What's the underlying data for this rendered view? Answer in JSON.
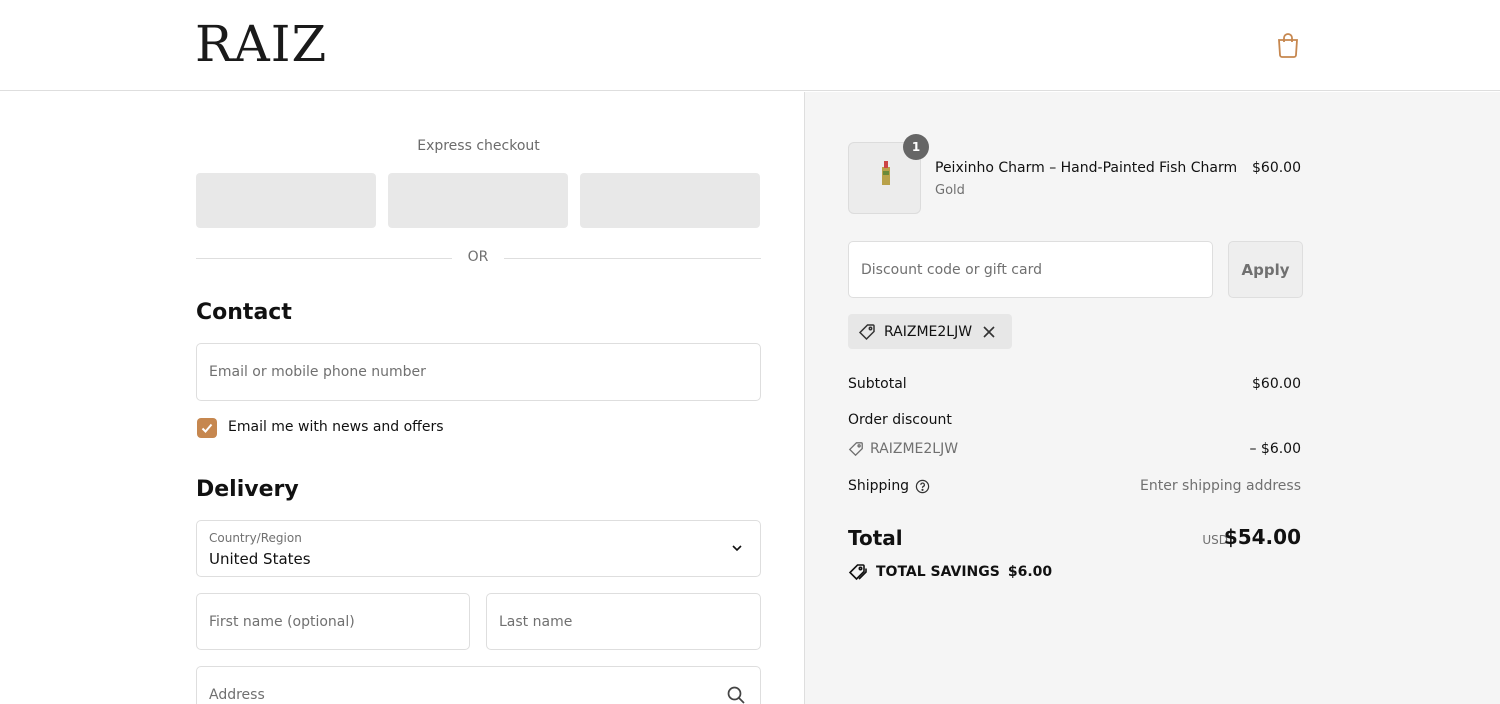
{
  "header": {
    "brand": "RAIZ",
    "cart_icon": "shopping-bag-icon"
  },
  "express": {
    "title": "Express checkout",
    "or_label": "OR"
  },
  "contact": {
    "title": "Contact",
    "email_placeholder": "Email or mobile phone number",
    "newsletter_label": "Email me with news and offers",
    "newsletter_checked": true
  },
  "delivery": {
    "title": "Delivery",
    "country_label": "Country/Region",
    "country_value": "United States",
    "first_name_placeholder": "First name (optional)",
    "last_name_placeholder": "Last name",
    "address_placeholder": "Address"
  },
  "summary": {
    "product": {
      "quantity": "1",
      "name": "Peixinho Charm – Hand-Painted Fish Charm",
      "variant": "Gold",
      "price": "$60.00"
    },
    "discount_placeholder": "Discount code or gift card",
    "apply_label": "Apply",
    "applied_code": "RAIZME2LJW",
    "subtotal_label": "Subtotal",
    "subtotal_value": "$60.00",
    "order_discount_label": "Order discount",
    "discount_code": "RAIZME2LJW",
    "discount_value": "– $6.00",
    "shipping_label": "Shipping",
    "shipping_value": "Enter shipping address",
    "total_label": "Total",
    "currency": "USD",
    "total_value": "$54.00",
    "savings_label": "TOTAL SAVINGS",
    "savings_value": "$6.00"
  },
  "colors": {
    "accent": "#c6874f",
    "summary_bg": "#f5f5f5",
    "border": "#dedede"
  }
}
